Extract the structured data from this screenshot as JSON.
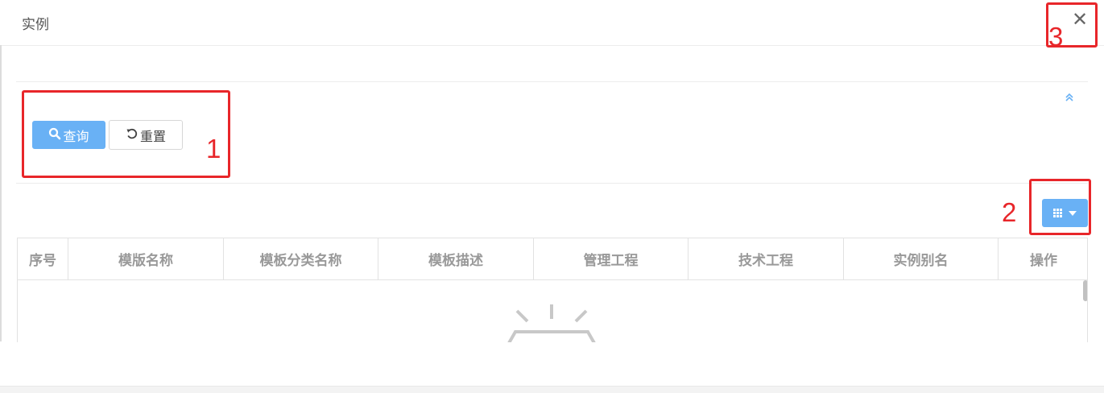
{
  "modal": {
    "title": "实例",
    "close_glyph": "✕"
  },
  "search": {
    "query_label": "查询",
    "reset_label": "重置"
  },
  "table": {
    "columns": [
      "序号",
      "模版名称",
      "模板分类名称",
      "模板描述",
      "管理工程",
      "技术工程",
      "实例别名",
      "操作"
    ],
    "rows": []
  },
  "annotations": {
    "one": "1",
    "two": "2",
    "three": "3"
  },
  "icons": {
    "query": "search-icon",
    "reset": "refresh-icon",
    "collapse": "double-chevron-up-icon",
    "column_toggle": "grid-icon",
    "close": "close-icon",
    "empty": "empty-data-icon"
  },
  "colors": {
    "primary": "#69b1f5",
    "annotation": "#e8262a",
    "header_text": "#999999"
  }
}
